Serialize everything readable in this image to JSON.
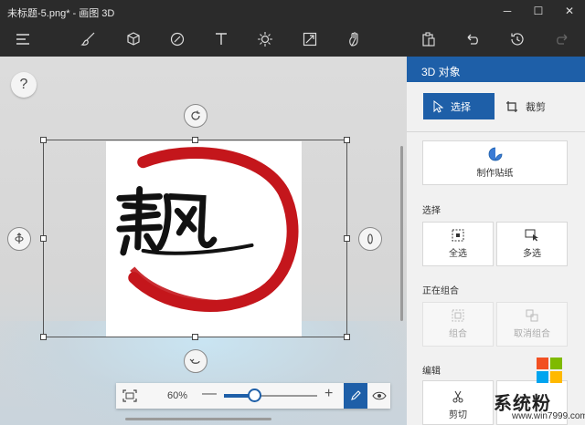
{
  "window": {
    "title": "未标题-5.png* - 画图 3D",
    "minimize": "─",
    "maximize": "☐",
    "close": "✕"
  },
  "canvas": {
    "help": "?"
  },
  "zoom": {
    "value": "60%",
    "minus": "—",
    "plus": "+",
    "level": 0.33
  },
  "panel": {
    "title": "3D 对象",
    "tool_select": "选择",
    "tool_crop": "裁剪",
    "make_sticker": "制作贴纸",
    "section_select": "选择",
    "select_all": "全选",
    "multi_select": "多选",
    "section_group": "正在组合",
    "group": "组合",
    "ungroup": "取消组合",
    "section_edit": "编辑",
    "cut": "剪切"
  },
  "watermark": {
    "text": "系统粉",
    "url": "www.win7999.com"
  },
  "colors": {
    "accent": "#1e5fa8",
    "brush_red": "#c4161c",
    "ink": "#111111"
  }
}
